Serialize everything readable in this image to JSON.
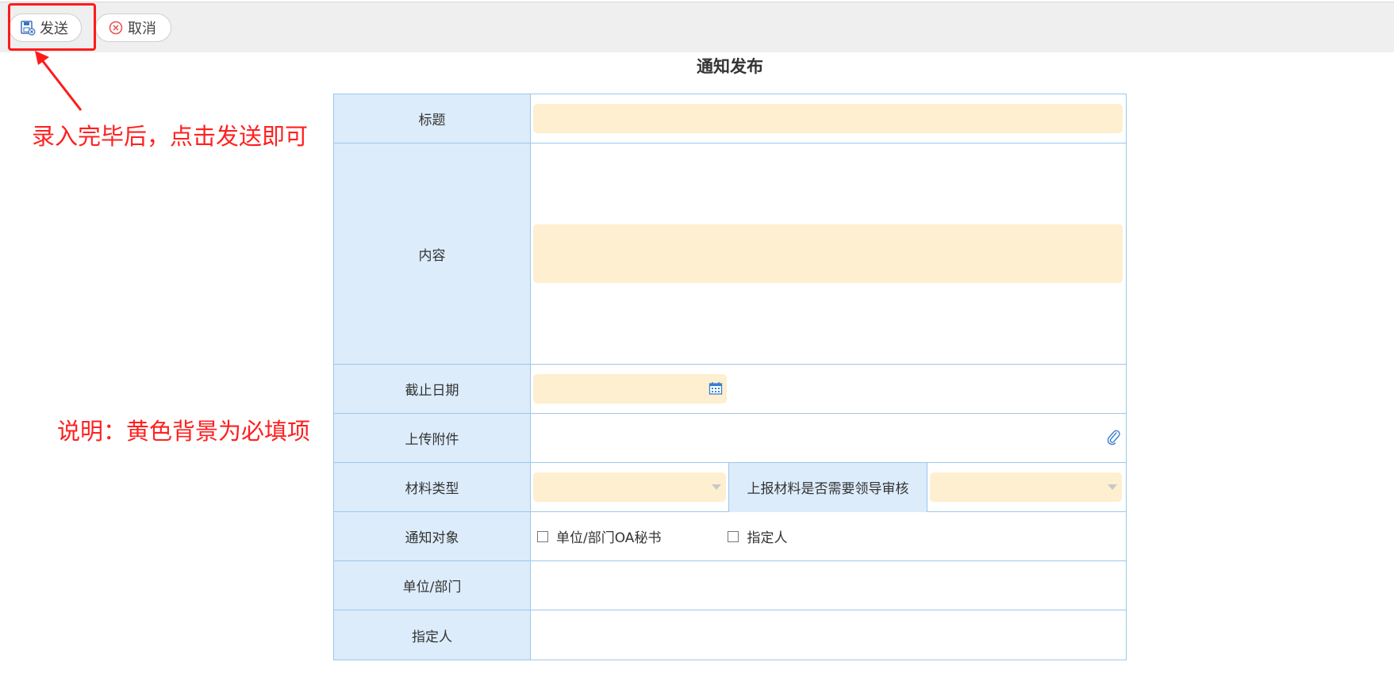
{
  "toolbar": {
    "send_label": "发送",
    "cancel_label": "取消",
    "send_icon": "save-send-icon",
    "cancel_icon": "cancel-circle-icon"
  },
  "annotations": {
    "send_hint": "录入完毕后，点击发送即可",
    "required_hint": "说明：黄色背景为必填项",
    "color": "#ff2020"
  },
  "form": {
    "title": "通知发布",
    "fields": {
      "title_label": "标题",
      "content_label": "内容",
      "deadline_label": "截止日期",
      "attachment_label": "上传附件",
      "material_type_label": "材料类型",
      "review_label": "上报材料是否需要领导审核",
      "target_label": "通知对象",
      "dept_label": "单位/部门",
      "assignee_label": "指定人"
    },
    "target_options": [
      "单位/部门OA秘书",
      "指定人"
    ],
    "required_color": "#fdefcf",
    "label_bg": "#dcecfb"
  }
}
